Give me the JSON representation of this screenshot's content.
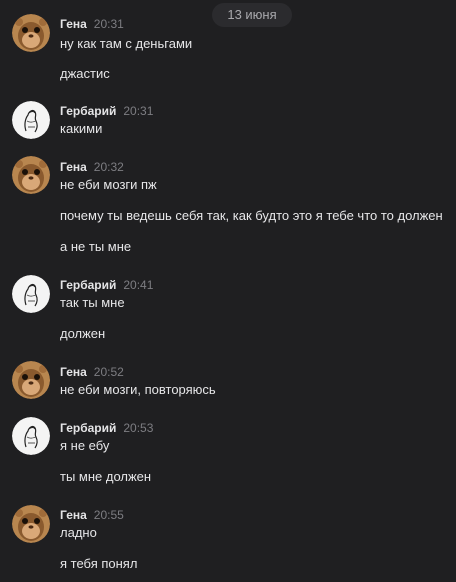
{
  "date_label": "13 июня",
  "colors": {
    "background": "#1f1f21",
    "date_pill": "#2b2b2e",
    "text": "#e6e6e8",
    "timestamp": "#7d7d82"
  },
  "groups": [
    {
      "author": "Гена",
      "time": "20:31",
      "avatar": "hamster-avatar",
      "messages": [
        "ну как там с деньгами",
        "джастис"
      ]
    },
    {
      "author": "Гербарий",
      "time": "20:31",
      "avatar": "sketch-avatar",
      "messages": [
        "какими"
      ]
    },
    {
      "author": "Гена",
      "time": "20:32",
      "avatar": "hamster-avatar",
      "messages": [
        "не еби мозги пж",
        "почему ты ведешь себя так, как будто это я тебе что то должен",
        "а не ты мне"
      ]
    },
    {
      "author": "Гербарий",
      "time": "20:41",
      "avatar": "sketch-avatar",
      "messages": [
        "так ты мне",
        "должен"
      ]
    },
    {
      "author": "Гена",
      "time": "20:52",
      "avatar": "hamster-avatar",
      "messages": [
        "не еби мозги, повторяюсь"
      ]
    },
    {
      "author": "Гербарий",
      "time": "20:53",
      "avatar": "sketch-avatar",
      "messages": [
        "я не ебу",
        "ты мне должен"
      ]
    },
    {
      "author": "Гена",
      "time": "20:55",
      "avatar": "hamster-avatar",
      "messages": [
        "ладно",
        "я тебя понял"
      ]
    }
  ]
}
